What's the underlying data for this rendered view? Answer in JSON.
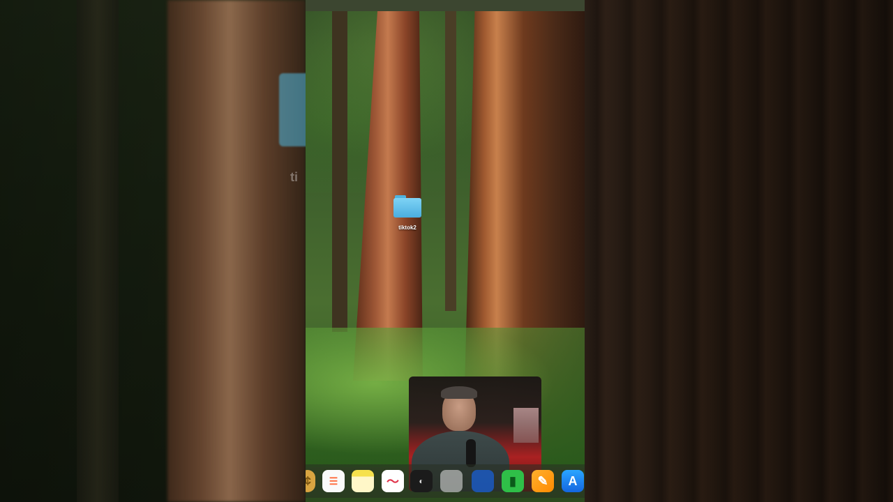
{
  "desktop": {
    "folder": {
      "label": "tiktok2",
      "icon": "folder-icon",
      "color": "#5ec3ec"
    }
  },
  "ghost": {
    "side_label": "ti"
  },
  "dock": {
    "items": [
      {
        "name": "coin-app-icon",
        "glyph": "¢"
      },
      {
        "name": "reminders-icon",
        "glyph": "☰"
      },
      {
        "name": "notes-icon",
        "glyph": ""
      },
      {
        "name": "freeform-icon",
        "glyph": "〜"
      },
      {
        "name": "unknown-app-icon",
        "glyph": "◐"
      },
      {
        "name": "unknown-app-icon-2",
        "glyph": ""
      },
      {
        "name": "unknown-app-icon-3",
        "glyph": ""
      },
      {
        "name": "numbers-icon",
        "glyph": "▮"
      },
      {
        "name": "pages-icon",
        "glyph": "✎"
      },
      {
        "name": "app-store-icon",
        "glyph": "A"
      }
    ]
  },
  "colors": {
    "folder": "#5ec3ec",
    "dock_bg": "#283022",
    "menubar": "#3c4630"
  }
}
